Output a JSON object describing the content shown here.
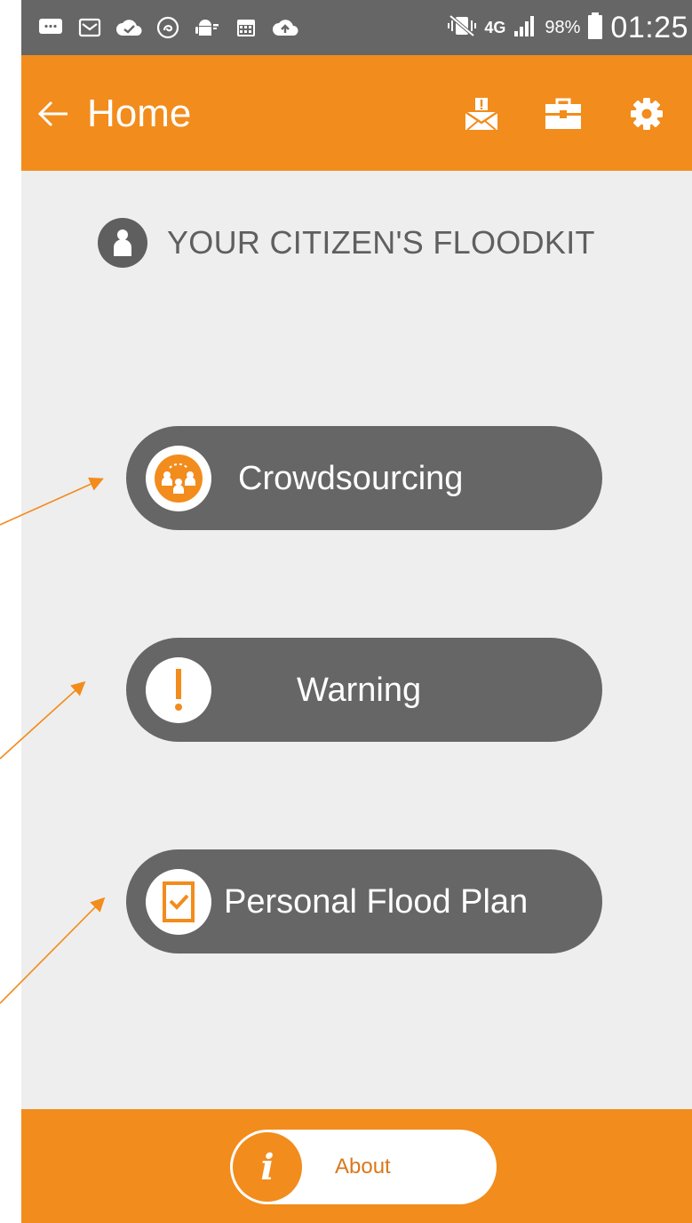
{
  "status_bar": {
    "icons": [
      "message-icon",
      "gmail-icon",
      "cloud-check-icon",
      "sync-icon",
      "android-icon",
      "calendar-icon",
      "cloud-upload-icon"
    ],
    "network": "4G",
    "battery": "98%",
    "time": "01:25"
  },
  "app_bar": {
    "title": "Home",
    "actions": [
      "alert-mail-icon",
      "briefcase-icon",
      "settings-gear-icon"
    ]
  },
  "heading": {
    "text": "YOUR CITIZEN'S FLOODKIT"
  },
  "menu": [
    {
      "label": "Crowdsourcing",
      "icon": "crowdsourcing-people-icon"
    },
    {
      "label": "Warning",
      "icon": "exclamation-icon"
    },
    {
      "label": "Personal Flood Plan",
      "icon": "checklist-icon"
    }
  ],
  "bottom_bar": {
    "about_label": "About",
    "about_icon_glyph": "i"
  },
  "colors": {
    "accent": "#f28c1c",
    "button_gray": "#666666",
    "background": "#eeeeee",
    "status_bar": "#666666"
  }
}
